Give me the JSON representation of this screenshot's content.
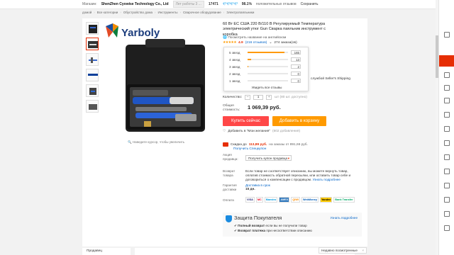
{
  "topbar": {
    "store_label": "Магазин:",
    "store_name": "ShenZhen Cyowise Technology Co., Ltd",
    "years": "Лет работы 3 ...",
    "score": "17471",
    "diamonds": "💎💎💎💎",
    "positive_pct": "98.1%",
    "positive_label": "положительных отзывов",
    "save_label": "Сохранить"
  },
  "breadcrumbs": [
    "домой",
    "Все категории",
    "Обустройство дома",
    "Инструменты",
    "Сварочное оборудование",
    "Электропаяльники"
  ],
  "product": {
    "brand": "Yarboly",
    "title": "60 Вт ЕС США 220 В/110 В Регулируемый Температура электрический утюг Gun Сварка паяльник инструмент с коробка",
    "translation_link": "Посмотреть название на английском",
    "rating_stars": "★★★★★",
    "rating": "4.9",
    "reviews_label": "(216 отзывов)",
    "orders_label": "274 заказа(ов)"
  },
  "rating_popup": {
    "rows": [
      {
        "label": "5 звезд",
        "count": 165,
        "fraction": 0.92
      },
      {
        "label": "4 звезд",
        "count": 13,
        "fraction": 0.08
      },
      {
        "label": "3 звезд",
        "count": 2,
        "fraction": 0.01
      },
      {
        "label": "2 звезд",
        "count": 0,
        "fraction": 0
      },
      {
        "label": "1 звезд",
        "count": 0,
        "fraction": 0
      }
    ],
    "all_reviews": "Увидеть все отзывы"
  },
  "shipping_note": "службой Seller's Shipping",
  "quantity": {
    "label": "Количество:",
    "minus": "–",
    "value": "1",
    "plus": "+",
    "available": "шт (80 шт. доступно)"
  },
  "total": {
    "label": "Общая стоимость:",
    "price": "1 069,39 руб."
  },
  "buttons": {
    "buy_now": "Купить сейчас",
    "add_to_cart": "Добавить в корзину",
    "wishlist_label": "Добавить в \"Мои желания\"",
    "wishlist_count": "(602 добавления)"
  },
  "coupon": {
    "prefix": "Скидка до",
    "amount": "113,89 руб.",
    "suffix": "на заказы от 891,66 руб.",
    "get_link": "Получить Спецкупон"
  },
  "promo": {
    "label": "Акция продавца:",
    "select_value": "Получить купон продавца"
  },
  "refund": {
    "label": "Возврат товара",
    "text": "Если товар не соответствует описанию, вы можете вернуть товар, оплатив стоимость обратной пересылки, или оставить товар себе и договориться о компенсации с продавцом.",
    "link": "Узнать подробнее"
  },
  "delivery": {
    "label": "Гарантия доставки",
    "text": "Доставка в срок",
    "days": "15 дн."
  },
  "payment": {
    "label": "Оплата",
    "methods": [
      "VISA",
      "MC",
      "Maestro",
      "AMEX",
      "QIWI",
      "WebMoney",
      "Yandex",
      "Bank Transfer"
    ]
  },
  "protection": {
    "title": "Защита Покупателя",
    "line1_bold": "Полный возврат",
    "line1_text": "если вы не получили товар",
    "line2_bold": "Возврат платежа",
    "line2_text": "при несоответствии описанию",
    "more": "Узнать подробнее"
  },
  "image_caption": "Наведите курсор, чтобы увеличить",
  "stores_label": "Продавец",
  "notify": {
    "label": "Недавно посмотренные",
    "close": "×"
  }
}
